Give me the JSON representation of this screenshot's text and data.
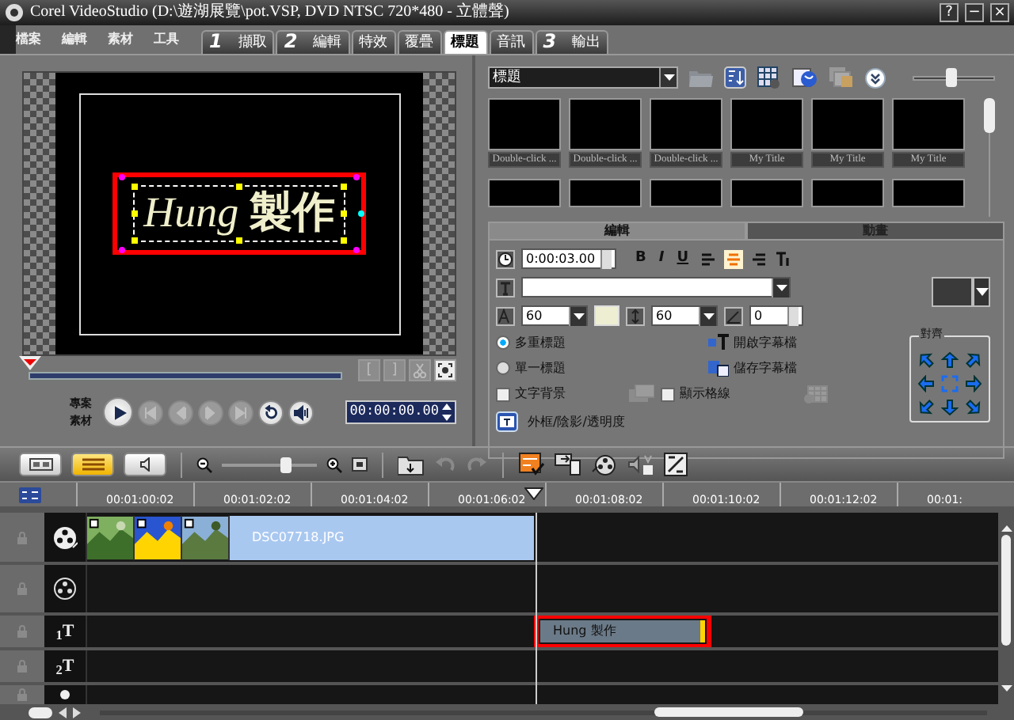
{
  "window": {
    "title": "Corel VideoStudio (D:\\遊湖展覽\\pot.VSP, DVD NTSC 720*480 - 立體聲)",
    "buttons": [
      "?",
      "−",
      "×"
    ]
  },
  "menu": [
    "檔案",
    "編輯",
    "素材",
    "工具"
  ],
  "steps": [
    {
      "number": "1",
      "label": "擷取",
      "selected": false
    },
    {
      "number": "2",
      "label": "編輯",
      "selected": false
    },
    {
      "label": "特效",
      "selected": false
    },
    {
      "label": "覆疊",
      "selected": false
    },
    {
      "label": "標題",
      "selected": true
    },
    {
      "label": "音訊",
      "selected": false
    },
    {
      "number": "3",
      "label": "輸出",
      "selected": false
    }
  ],
  "preview": {
    "title_text": "*Hung* **製作**",
    "highlighted": true,
    "scrubber": {
      "level": 0
    },
    "trim_buttons": [
      "[",
      "]"
    ],
    "mode_labels": [
      "專案",
      "素材"
    ],
    "transport": [
      {
        "kind": "play",
        "disabled": false
      },
      {
        "kind": "start",
        "disabled": true
      },
      {
        "kind": "prev",
        "disabled": true
      },
      {
        "kind": "next",
        "disabled": true
      },
      {
        "kind": "end",
        "disabled": true
      },
      {
        "kind": "repeat",
        "disabled": false
      },
      {
        "kind": "volume",
        "disabled": false
      }
    ],
    "timecode": "00:00:00.00"
  },
  "library": {
    "category": "標題",
    "size_slider": {
      "level": 0.45
    },
    "thumbnails": [
      {
        "caption": "Double-click ..."
      },
      {
        "caption": "Double-click ..."
      },
      {
        "caption": "Double-click ..."
      },
      {
        "caption": "My Title"
      },
      {
        "caption": "My Title"
      },
      {
        "caption": "My Title"
      },
      {
        "kind": "partial"
      },
      {
        "kind": "partial"
      },
      {
        "kind": "partial"
      },
      {
        "kind": "partial"
      },
      {
        "kind": "partial"
      },
      {
        "kind": "partial"
      }
    ]
  },
  "options": {
    "tabs": [
      {
        "label": "編輯",
        "selected": true
      },
      {
        "label": "動畫",
        "selected": false
      }
    ],
    "duration": "0:00:03.00",
    "styles": [
      {
        "label": "B",
        "selected": false
      },
      {
        "label": "I",
        "selected": false
      },
      {
        "label": "U",
        "selected": false
      }
    ],
    "alignment": [
      {
        "selected": false
      },
      {
        "selected": true
      },
      {
        "selected": false
      }
    ],
    "font_size": "60",
    "text_color": {
      "color": "#eeeed2"
    },
    "line_spacing": "60",
    "angle": "0",
    "title_modes": [
      {
        "label": "多重標題",
        "selected": true
      },
      {
        "label": "單一標題",
        "selected": false
      }
    ],
    "subtitle_buttons": [
      "開啟字幕檔",
      "儲存字幕檔"
    ],
    "checkboxes": [
      {
        "label": "文字背景",
        "checked": false
      },
      {
        "label": "顯示格線",
        "checked": false
      }
    ],
    "border_button": "外框/陰影/透明度",
    "background_color": {
      "color": "#3a3a3a"
    },
    "align_group": "對齊"
  },
  "timeline": {
    "views": [
      {
        "selected": false
      },
      {
        "selected": true
      },
      {
        "selected": false
      }
    ],
    "zoom": {
      "level": 0.68
    },
    "ruler": [
      "00:01:00:02",
      "00:01:02:02",
      "00:01:04:02",
      "00:01:06:02",
      "00:01:08:02",
      "00:01:10:02",
      "00:01:12:02",
      "00:01:"
    ],
    "tracks": [
      {
        "kind": "video",
        "clips": [
          {
            "kind": "picture"
          },
          {
            "kind": "picture"
          },
          {
            "kind": "picture"
          },
          {
            "name": "DSC07718.JPG"
          }
        ]
      },
      {
        "kind": "overlay"
      },
      {
        "kind": "title",
        "label": "$_{1}$T",
        "clips": [
          {
            "kind": "title",
            "text": "Hung 製作",
            "highlighted": true
          }
        ]
      },
      {
        "kind": "title",
        "label": "$_{2}$T"
      },
      {
        "kind": "voice"
      }
    ]
  }
}
